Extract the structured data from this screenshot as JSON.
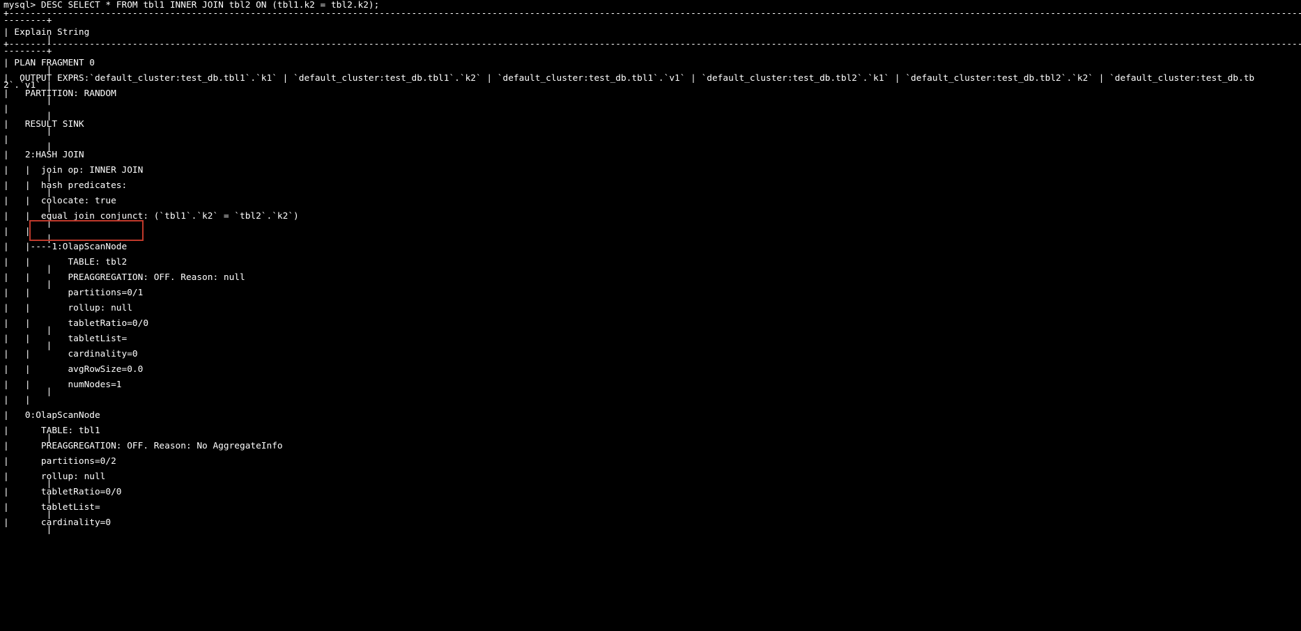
{
  "terminal": {
    "lines": [
      "mysql> DESC SELECT * FROM tbl1 INNER JOIN tbl2 ON (tbl1.k2 = tbl2.k2);",
      "+-----------------------------------------------------------------------------------------------------------------------------------------------------------------------------------------------------------------------------------------------------------------------------------------------------",
      "--------+",
      "| Explain String",
      "        |",
      "+-----------------------------------------------------------------------------------------------------------------------------------------------------------------------------------------------------------------------------------------------------------------------------------------------------",
      "--------+",
      "| PLAN FRAGMENT 0",
      "        |",
      "|  OUTPUT EXPRS:`default_cluster:test_db.tbl1`.`k1` | `default_cluster:test_db.tbl1`.`k2` | `default_cluster:test_db.tbl1`.`v1` | `default_cluster:test_db.tbl2`.`k1` | `default_cluster:test_db.tbl2`.`k2` | `default_cluster:test_db.tb",
      "2`.`v1` |",
      "|   PARTITION: RANDOM",
      "        |",
      "|",
      "        |",
      "|   RESULT SINK",
      "        |",
      "|",
      "        |",
      "|   2:HASH JOIN",
      "|   |  join op: INNER JOIN",
      "        |",
      "|   |  hash predicates:",
      "        |",
      "|   |  colocate: true",
      "        |",
      "|   |  equal join conjunct: (`tbl1`.`k2` = `tbl2`.`k2`)",
      "        |",
      "|   |",
      "        |",
      "|   |----1:OlapScanNode",
      "|   |       TABLE: tbl2",
      "        |",
      "|   |       PREAGGREGATION: OFF. Reason: null",
      "        |",
      "|   |       partitions=0/1",
      "|   |       rollup: null",
      "|   |       tabletRatio=0/0",
      "        |",
      "|   |       tabletList=",
      "        |",
      "|   |       cardinality=0",
      "|   |       avgRowSize=0.0",
      "|   |       numNodes=1",
      "        |",
      "|   |",
      "|   0:OlapScanNode",
      "|      TABLE: tbl1",
      "        |",
      "|      PREAGGREGATION: OFF. Reason: No AggregateInfo",
      "|      partitions=0/2",
      "|      rollup: null",
      "        |",
      "|      tabletRatio=0/0",
      "        |",
      "|      tabletList=",
      "        |",
      "|      cardinality=0",
      "        |"
    ]
  }
}
